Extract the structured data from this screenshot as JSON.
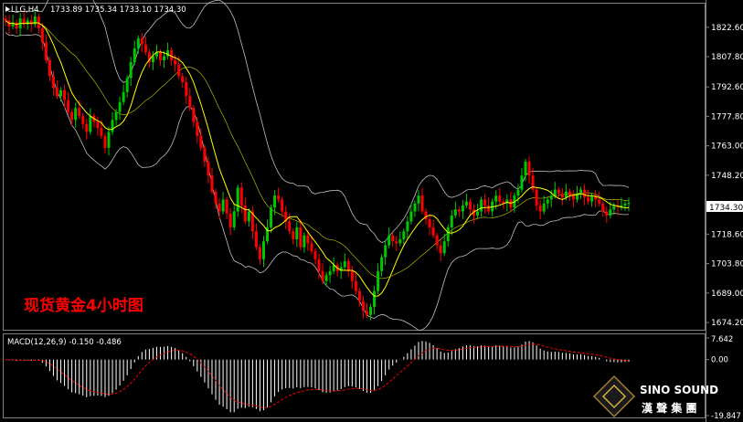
{
  "window": {
    "symbol_label": "LLG,H4",
    "ohlc_readout": "1733.89 1735.34 1733.10 1734.30"
  },
  "overlay_title": "现货黄金4小时图",
  "macd_label": "MACD(12,26,9) -0.150 -0.486",
  "watermark": {
    "brand": "SINO SOUND",
    "chinese": "漢 聲 集 團"
  },
  "colors": {
    "background": "#000000",
    "bull": "#00c800",
    "bear": "#ff0000",
    "ma": "#ffff00",
    "bands": "#bfbfbf",
    "text": "#ffffff",
    "title": "#ff0000",
    "macd_signal": "#ff0000",
    "macd_hist": "#ffffff",
    "price_tag_bg": "#ffffff",
    "price_tag_text": "#000000"
  },
  "chart_data": [
    {
      "type": "candlestick",
      "timeframe": "H4",
      "yaxis_ticks": [
        "1822.60",
        "1807.80",
        "1792.60",
        "1777.80",
        "1763.00",
        "1748.20",
        "1734.30",
        "1718.60",
        "1703.80",
        "1689.00",
        "1674.20"
      ],
      "ylim": [
        1671,
        1834
      ],
      "current_price": "1734.30",
      "indicators": [
        "moving_average",
        "bollinger_bands"
      ],
      "series": [
        {
          "close": [
            1826,
            1823,
            1825,
            1822,
            1827,
            1824,
            1826,
            1824,
            1828,
            1822,
            1815,
            1806,
            1798,
            1792,
            1788,
            1791,
            1786,
            1780,
            1776,
            1782,
            1778,
            1774,
            1770,
            1778,
            1775,
            1772,
            1768,
            1762,
            1770,
            1776,
            1780,
            1785,
            1790,
            1797,
            1805,
            1812,
            1817,
            1814,
            1810,
            1805,
            1808,
            1810,
            1806,
            1808,
            1811,
            1806,
            1804,
            1798,
            1795,
            1788,
            1782,
            1775,
            1768,
            1762,
            1755,
            1748,
            1740,
            1734,
            1730,
            1736,
            1729,
            1722,
            1730,
            1742,
            1733,
            1725,
            1730,
            1720,
            1712,
            1706,
            1715,
            1722,
            1732,
            1738,
            1736,
            1730,
            1725,
            1720,
            1716,
            1722,
            1712,
            1718,
            1714,
            1710,
            1706,
            1700,
            1695,
            1698,
            1700,
            1703,
            1700,
            1702,
            1705,
            1700,
            1695,
            1690,
            1685,
            1680,
            1678,
            1682,
            1690,
            1700,
            1707,
            1713,
            1718,
            1715,
            1714,
            1716,
            1720,
            1725,
            1730,
            1734,
            1738,
            1730,
            1726,
            1722,
            1718,
            1713,
            1709,
            1715,
            1722,
            1728,
            1731,
            1730,
            1733,
            1735,
            1731,
            1728,
            1730,
            1736,
            1733,
            1730,
            1735,
            1738,
            1735,
            1734,
            1736,
            1732,
            1738,
            1741,
            1748,
            1755,
            1748,
            1741,
            1733,
            1730,
            1734,
            1736,
            1738,
            1741,
            1739,
            1737,
            1740,
            1738,
            1736,
            1739,
            1741,
            1737,
            1735,
            1738,
            1736,
            1734,
            1730,
            1728,
            1731,
            1733,
            1732,
            1733,
            1734,
            1734.3
          ]
        }
      ]
    },
    {
      "type": "bar",
      "name": "MACD",
      "params": "12,26,9",
      "yaxis_ticks": [
        "7.642",
        "0.00",
        "-19.847"
      ],
      "ylim": [
        -19.847,
        7.642
      ],
      "last_values": {
        "macd": -0.15,
        "signal": -0.486
      }
    }
  ]
}
